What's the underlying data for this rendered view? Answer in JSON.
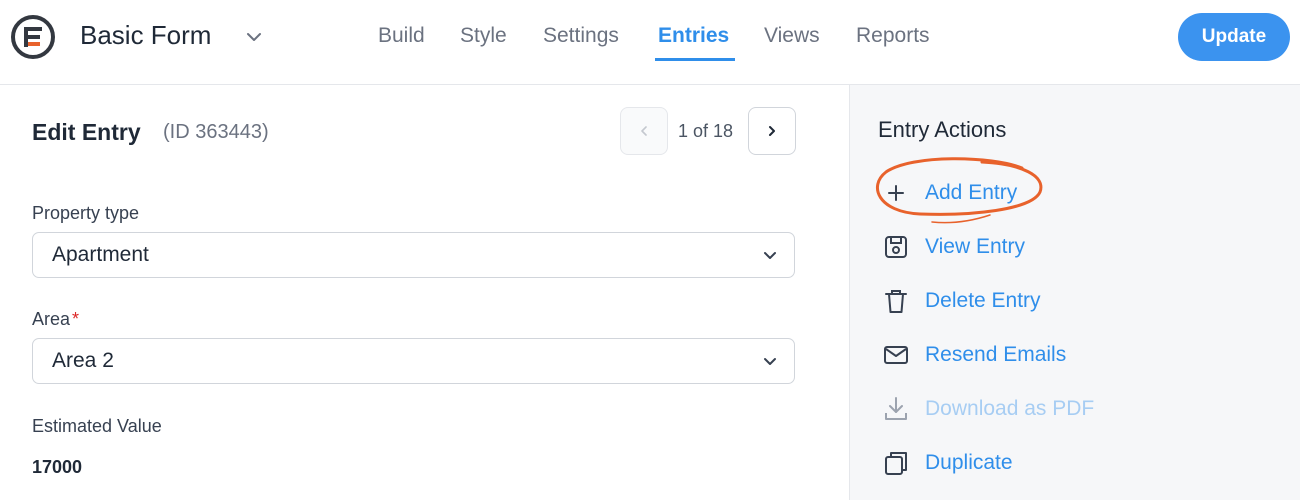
{
  "header": {
    "form_title": "Basic Form",
    "tabs": [
      {
        "label": "Build",
        "active": false
      },
      {
        "label": "Style",
        "active": false
      },
      {
        "label": "Settings",
        "active": false
      },
      {
        "label": "Entries",
        "active": true
      },
      {
        "label": "Views",
        "active": false
      },
      {
        "label": "Reports",
        "active": false
      }
    ],
    "update_label": "Update"
  },
  "main": {
    "title": "Edit Entry",
    "entry_id": "(ID 363443)",
    "pager": {
      "text": "1 of 18"
    },
    "fields": [
      {
        "label": "Property type",
        "value": "Apartment",
        "type": "select"
      },
      {
        "label": "Area",
        "required_mark": "*",
        "value": "Area 2",
        "type": "select"
      },
      {
        "label": "Estimated Value",
        "value": "17000",
        "type": "read-only"
      }
    ]
  },
  "sidebar": {
    "title": "Entry Actions",
    "actions": [
      {
        "label": "Add Entry",
        "icon": "plus-icon",
        "highlighted": true
      },
      {
        "label": "View Entry",
        "icon": "save-icon"
      },
      {
        "label": "Delete Entry",
        "icon": "trash-icon"
      },
      {
        "label": "Resend Emails",
        "icon": "envelope-icon"
      },
      {
        "label": "Download as PDF",
        "icon": "download-icon",
        "disabled": true
      },
      {
        "label": "Duplicate",
        "icon": "duplicate-icon"
      }
    ]
  },
  "colors": {
    "accent": "#2f8eea",
    "update_button": "#3b93ef",
    "highlight_ring": "#e8622c",
    "required": "#dc2626",
    "disabled_link": "#a7cdf3",
    "sidebar_bg": "#f6f7f9"
  }
}
